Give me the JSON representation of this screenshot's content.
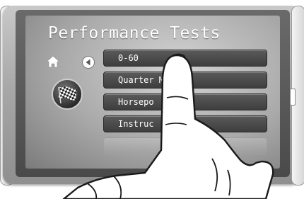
{
  "screen": {
    "title": "Performance Tests"
  },
  "icons": {
    "home": "home-icon",
    "back": "back-arrow-icon",
    "flag": "checkered-flag-icon"
  },
  "menu": {
    "items": [
      {
        "label": "0-60"
      },
      {
        "label": "Quarter M"
      },
      {
        "label": "Horsepo"
      },
      {
        "label": "Instruc"
      },
      {
        "label": ""
      }
    ]
  }
}
